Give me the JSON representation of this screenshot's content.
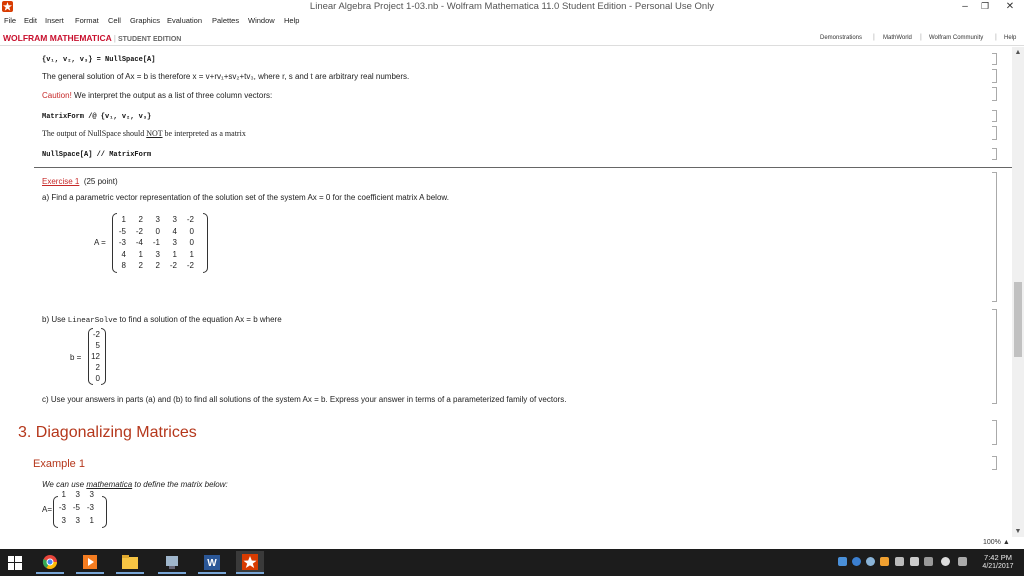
{
  "window": {
    "title": "Linear Algebra Project 1-03.nb - Wolfram Mathematica 11.0 Student Edition - Personal Use Only",
    "min_label": "–",
    "max_label": "❐",
    "close_label": "✕"
  },
  "menu": [
    "File",
    "Edit",
    "Insert",
    "Format",
    "Cell",
    "Graphics",
    "Evaluation",
    "Palettes",
    "Window",
    "Help"
  ],
  "brand": {
    "primary": "WOLFRAM MATHEMATICA",
    "secondary": "STUDENT EDITION"
  },
  "toplinks": [
    "Demonstrations",
    "MathWorld",
    "Wolfram Community",
    "Help"
  ],
  "cells": {
    "code1": "{v₁, v₂, v₃} = NullSpace[A]",
    "text1": "The general solution of Ax = b is therefore x = v+rv₁+sv₂+tv₃, where r, s and t are arbitrary real numbers.",
    "caution": "Caution!",
    "caution_rest": "We interpret the output as a list of three column vectors:",
    "code2": "MatrixForm /@ {v₁, v₂, v₃}",
    "text2_a": "The output of NullSpace should",
    "text2_not": "NOT",
    "text2_b": "be interpreted as a matrix",
    "code3": "NullSpace[A] // MatrixForm"
  },
  "exercise": {
    "link": "Exercise 1",
    "points": "(25 point)",
    "part_a": "a)  Find a parametric vector representation of the solution set of the system Ax = 0 for the coefficient matrix A below.",
    "matrix_label": "A =",
    "matrix_A": [
      [
        "1",
        "2",
        "3",
        "3",
        "-2"
      ],
      [
        "-5",
        "-2",
        "0",
        "4",
        "0"
      ],
      [
        "-3",
        "-4",
        "-1",
        "3",
        "0"
      ],
      [
        "4",
        "1",
        "3",
        "1",
        "1"
      ],
      [
        "8",
        "2",
        "2",
        "-2",
        "-2"
      ]
    ],
    "part_b_pre": "b)  Use",
    "part_b_code": "LinearSolve",
    "part_b_post": "to find a solution of the equation Ax = b where",
    "vector_label": "b =",
    "vector_b": [
      "-2",
      "5",
      "12",
      "2",
      "0"
    ],
    "part_c": "c)  Use your answers in parts (a) and (b) to find all solutions of the system Ax = b.  Express your answer in terms of a parameterized family of vectors."
  },
  "section": {
    "title": "3.  Diagonalizing Matrices",
    "example": "Example 1",
    "example_text_pre": "We can use",
    "example_link": "mathematica",
    "example_text_post": "to define the matrix below:",
    "matrix_label": "A=",
    "matrix": [
      [
        "1",
        "3",
        "3"
      ],
      [
        "-3",
        "-5",
        "-3"
      ],
      [
        "3",
        "3",
        "1"
      ]
    ]
  },
  "status": {
    "zoom": "100%"
  },
  "taskbar": {
    "time": "7:42 PM",
    "date": "4/21/2017"
  }
}
